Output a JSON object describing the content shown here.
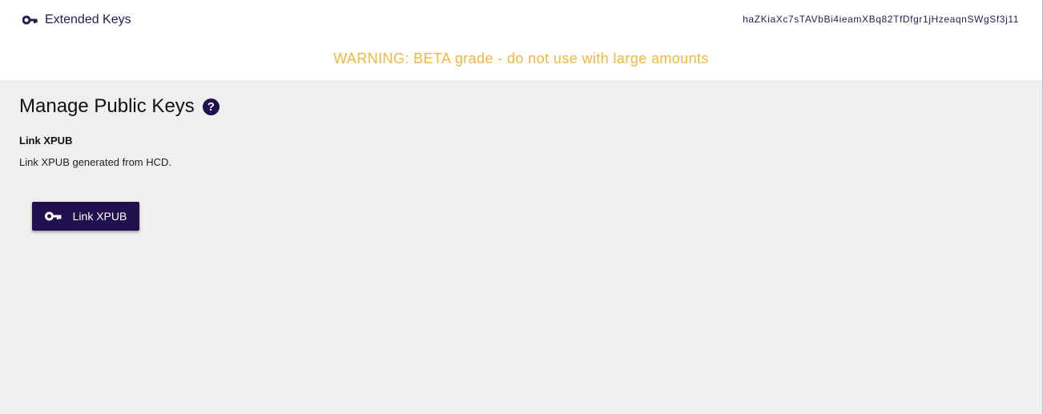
{
  "header": {
    "app_title": "Extended Keys",
    "app_icon": "key-icon",
    "account_id": "haZKiaXc7sTAVbBi4ieamXBq82TfDfgr1jHzeaqnSWgSf3j11",
    "warning": "WARNING: BETA grade - do not use with large amounts"
  },
  "main": {
    "title": "Manage Public Keys",
    "help_icon": "help-icon",
    "help_glyph": "?",
    "section": {
      "title": "Link XPUB",
      "description": "Link XPUB generated from HCD."
    },
    "button": {
      "label": "Link XPUB",
      "icon": "key-icon"
    }
  },
  "colors": {
    "primary": "#22104e",
    "warning": "#f4b63a",
    "header_bg": "#ffffff",
    "body_bg": "#efefef"
  }
}
